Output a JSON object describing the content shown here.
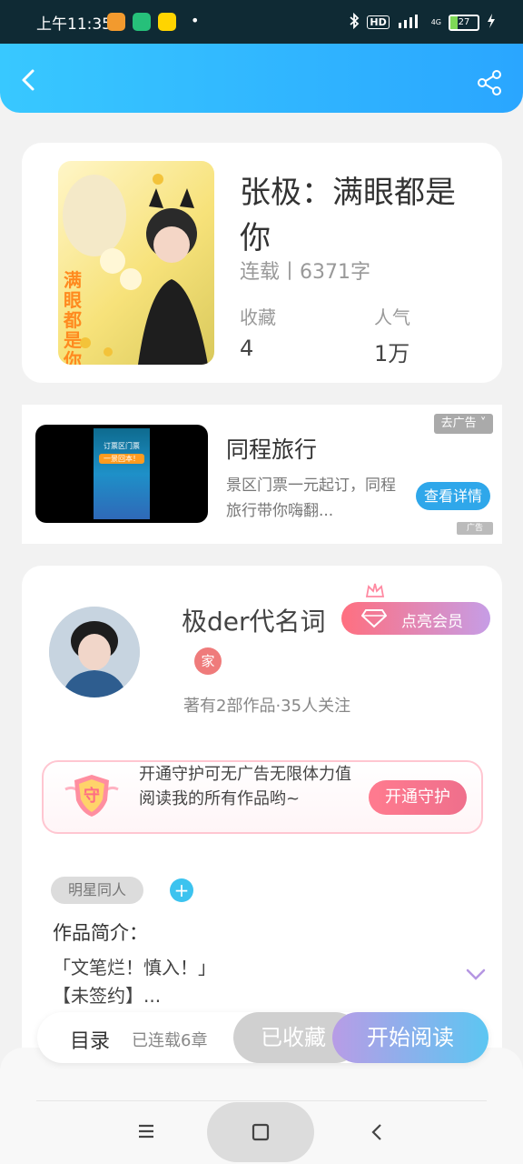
{
  "status_bar": {
    "time": "上午11:35",
    "battery": "27",
    "hd_label": "HD",
    "network_label": "4G",
    "colors": {
      "weibo": "#f29a2e",
      "shield": "#26c07a",
      "qq": "#ffd400"
    }
  },
  "header": {
    "back_icon": "chevron-left-icon",
    "share_icon": "share-icon"
  },
  "book": {
    "title": "张极：满眼都是你",
    "status": "连载丨6371字",
    "favorites_label": "收藏",
    "favorites_value": "4",
    "popularity_label": "人气",
    "popularity_value": "1万",
    "cover_text": "满眼都是你"
  },
  "ad": {
    "title": "同程旅行",
    "description": "景区门票一元起订，同程旅行带你嗨翻...",
    "remove_label": "去广告",
    "detail_button": "查看详情",
    "ad_tag": "广告",
    "thumb_text_1": "订票区门票",
    "thumb_text_2": "一景回本！"
  },
  "author": {
    "name": "极der代名词",
    "vip_button": "点亮会员",
    "badge": "家",
    "meta": "著有2部作品·35人关注",
    "guard_text": "开通守护可无广告无限体力值阅读我的所有作品哟~",
    "guard_button": "开通守护",
    "guard_badge": "守"
  },
  "tags": {
    "tag1": "明星同人",
    "add": "+"
  },
  "intro": {
    "label": "作品简介：",
    "line1": "「文笔烂！慎入！」",
    "line2": "【未签约】..."
  },
  "bottom_bar": {
    "toc_label": "目录",
    "toc_count": "已连载6章",
    "fav_button": "已收藏",
    "read_button": "开始阅读"
  },
  "nav": {
    "menu_icon": "menu-icon",
    "home_icon": "home-icon",
    "back_icon": "back-icon"
  }
}
